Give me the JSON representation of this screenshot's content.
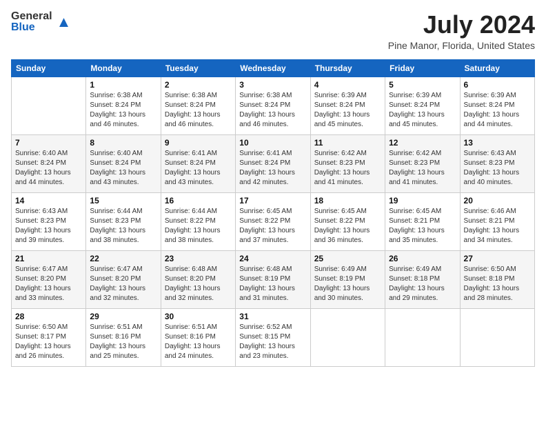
{
  "header": {
    "logo_general": "General",
    "logo_blue": "Blue",
    "title": "July 2024",
    "subtitle": "Pine Manor, Florida, United States"
  },
  "calendar": {
    "days_of_week": [
      "Sunday",
      "Monday",
      "Tuesday",
      "Wednesday",
      "Thursday",
      "Friday",
      "Saturday"
    ],
    "rows": [
      [
        {
          "day": "",
          "sunrise": "",
          "sunset": "",
          "daylight": ""
        },
        {
          "day": "1",
          "sunrise": "Sunrise: 6:38 AM",
          "sunset": "Sunset: 8:24 PM",
          "daylight": "Daylight: 13 hours and 46 minutes."
        },
        {
          "day": "2",
          "sunrise": "Sunrise: 6:38 AM",
          "sunset": "Sunset: 8:24 PM",
          "daylight": "Daylight: 13 hours and 46 minutes."
        },
        {
          "day": "3",
          "sunrise": "Sunrise: 6:38 AM",
          "sunset": "Sunset: 8:24 PM",
          "daylight": "Daylight: 13 hours and 46 minutes."
        },
        {
          "day": "4",
          "sunrise": "Sunrise: 6:39 AM",
          "sunset": "Sunset: 8:24 PM",
          "daylight": "Daylight: 13 hours and 45 minutes."
        },
        {
          "day": "5",
          "sunrise": "Sunrise: 6:39 AM",
          "sunset": "Sunset: 8:24 PM",
          "daylight": "Daylight: 13 hours and 45 minutes."
        },
        {
          "day": "6",
          "sunrise": "Sunrise: 6:39 AM",
          "sunset": "Sunset: 8:24 PM",
          "daylight": "Daylight: 13 hours and 44 minutes."
        }
      ],
      [
        {
          "day": "7",
          "sunrise": "Sunrise: 6:40 AM",
          "sunset": "Sunset: 8:24 PM",
          "daylight": "Daylight: 13 hours and 44 minutes."
        },
        {
          "day": "8",
          "sunrise": "Sunrise: 6:40 AM",
          "sunset": "Sunset: 8:24 PM",
          "daylight": "Daylight: 13 hours and 43 minutes."
        },
        {
          "day": "9",
          "sunrise": "Sunrise: 6:41 AM",
          "sunset": "Sunset: 8:24 PM",
          "daylight": "Daylight: 13 hours and 43 minutes."
        },
        {
          "day": "10",
          "sunrise": "Sunrise: 6:41 AM",
          "sunset": "Sunset: 8:24 PM",
          "daylight": "Daylight: 13 hours and 42 minutes."
        },
        {
          "day": "11",
          "sunrise": "Sunrise: 6:42 AM",
          "sunset": "Sunset: 8:23 PM",
          "daylight": "Daylight: 13 hours and 41 minutes."
        },
        {
          "day": "12",
          "sunrise": "Sunrise: 6:42 AM",
          "sunset": "Sunset: 8:23 PM",
          "daylight": "Daylight: 13 hours and 41 minutes."
        },
        {
          "day": "13",
          "sunrise": "Sunrise: 6:43 AM",
          "sunset": "Sunset: 8:23 PM",
          "daylight": "Daylight: 13 hours and 40 minutes."
        }
      ],
      [
        {
          "day": "14",
          "sunrise": "Sunrise: 6:43 AM",
          "sunset": "Sunset: 8:23 PM",
          "daylight": "Daylight: 13 hours and 39 minutes."
        },
        {
          "day": "15",
          "sunrise": "Sunrise: 6:44 AM",
          "sunset": "Sunset: 8:23 PM",
          "daylight": "Daylight: 13 hours and 38 minutes."
        },
        {
          "day": "16",
          "sunrise": "Sunrise: 6:44 AM",
          "sunset": "Sunset: 8:22 PM",
          "daylight": "Daylight: 13 hours and 38 minutes."
        },
        {
          "day": "17",
          "sunrise": "Sunrise: 6:45 AM",
          "sunset": "Sunset: 8:22 PM",
          "daylight": "Daylight: 13 hours and 37 minutes."
        },
        {
          "day": "18",
          "sunrise": "Sunrise: 6:45 AM",
          "sunset": "Sunset: 8:22 PM",
          "daylight": "Daylight: 13 hours and 36 minutes."
        },
        {
          "day": "19",
          "sunrise": "Sunrise: 6:45 AM",
          "sunset": "Sunset: 8:21 PM",
          "daylight": "Daylight: 13 hours and 35 minutes."
        },
        {
          "day": "20",
          "sunrise": "Sunrise: 6:46 AM",
          "sunset": "Sunset: 8:21 PM",
          "daylight": "Daylight: 13 hours and 34 minutes."
        }
      ],
      [
        {
          "day": "21",
          "sunrise": "Sunrise: 6:47 AM",
          "sunset": "Sunset: 8:20 PM",
          "daylight": "Daylight: 13 hours and 33 minutes."
        },
        {
          "day": "22",
          "sunrise": "Sunrise: 6:47 AM",
          "sunset": "Sunset: 8:20 PM",
          "daylight": "Daylight: 13 hours and 32 minutes."
        },
        {
          "day": "23",
          "sunrise": "Sunrise: 6:48 AM",
          "sunset": "Sunset: 8:20 PM",
          "daylight": "Daylight: 13 hours and 32 minutes."
        },
        {
          "day": "24",
          "sunrise": "Sunrise: 6:48 AM",
          "sunset": "Sunset: 8:19 PM",
          "daylight": "Daylight: 13 hours and 31 minutes."
        },
        {
          "day": "25",
          "sunrise": "Sunrise: 6:49 AM",
          "sunset": "Sunset: 8:19 PM",
          "daylight": "Daylight: 13 hours and 30 minutes."
        },
        {
          "day": "26",
          "sunrise": "Sunrise: 6:49 AM",
          "sunset": "Sunset: 8:18 PM",
          "daylight": "Daylight: 13 hours and 29 minutes."
        },
        {
          "day": "27",
          "sunrise": "Sunrise: 6:50 AM",
          "sunset": "Sunset: 8:18 PM",
          "daylight": "Daylight: 13 hours and 28 minutes."
        }
      ],
      [
        {
          "day": "28",
          "sunrise": "Sunrise: 6:50 AM",
          "sunset": "Sunset: 8:17 PM",
          "daylight": "Daylight: 13 hours and 26 minutes."
        },
        {
          "day": "29",
          "sunrise": "Sunrise: 6:51 AM",
          "sunset": "Sunset: 8:16 PM",
          "daylight": "Daylight: 13 hours and 25 minutes."
        },
        {
          "day": "30",
          "sunrise": "Sunrise: 6:51 AM",
          "sunset": "Sunset: 8:16 PM",
          "daylight": "Daylight: 13 hours and 24 minutes."
        },
        {
          "day": "31",
          "sunrise": "Sunrise: 6:52 AM",
          "sunset": "Sunset: 8:15 PM",
          "daylight": "Daylight: 13 hours and 23 minutes."
        },
        {
          "day": "",
          "sunrise": "",
          "sunset": "",
          "daylight": ""
        },
        {
          "day": "",
          "sunrise": "",
          "sunset": "",
          "daylight": ""
        },
        {
          "day": "",
          "sunrise": "",
          "sunset": "",
          "daylight": ""
        }
      ]
    ]
  }
}
